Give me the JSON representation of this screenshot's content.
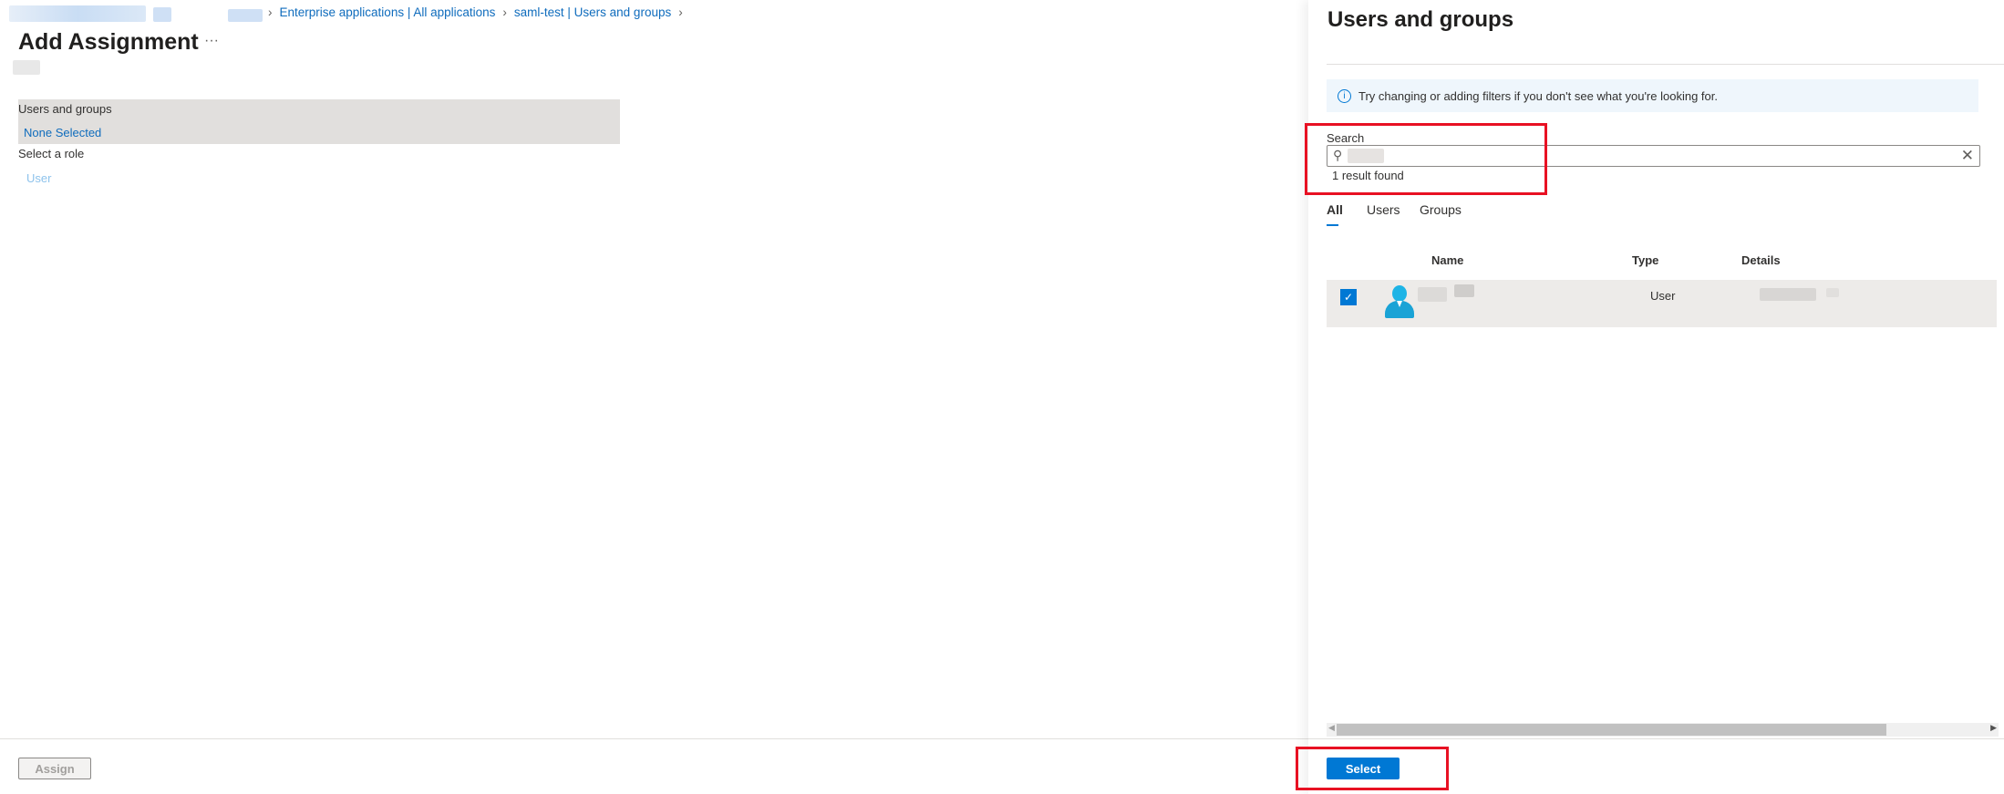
{
  "breadcrumb": {
    "items": [
      "Enterprise applications | All applications",
      "saml-test | Users and groups"
    ]
  },
  "page": {
    "title": "Add Assignment",
    "more_label": "···"
  },
  "form": {
    "users_groups_label": "Users and groups",
    "users_groups_value": "None Selected",
    "role_label": "Select a role",
    "role_value": "User"
  },
  "footer": {
    "assign_label": "Assign"
  },
  "panel": {
    "title": "Users and groups",
    "info_text": "Try changing or adding filters if you don't see what you're looking for.",
    "search_label": "Search",
    "result_count": "1 result found",
    "tabs": [
      {
        "label": "All",
        "active": true
      },
      {
        "label": "Users"
      },
      {
        "label": "Groups"
      }
    ],
    "columns": [
      "Name",
      "Type",
      "Details"
    ],
    "rows": [
      {
        "checked": true,
        "type": "User"
      }
    ],
    "select_label": "Select"
  },
  "colors": {
    "accent": "#0078d4",
    "highlight": "#e81123"
  }
}
